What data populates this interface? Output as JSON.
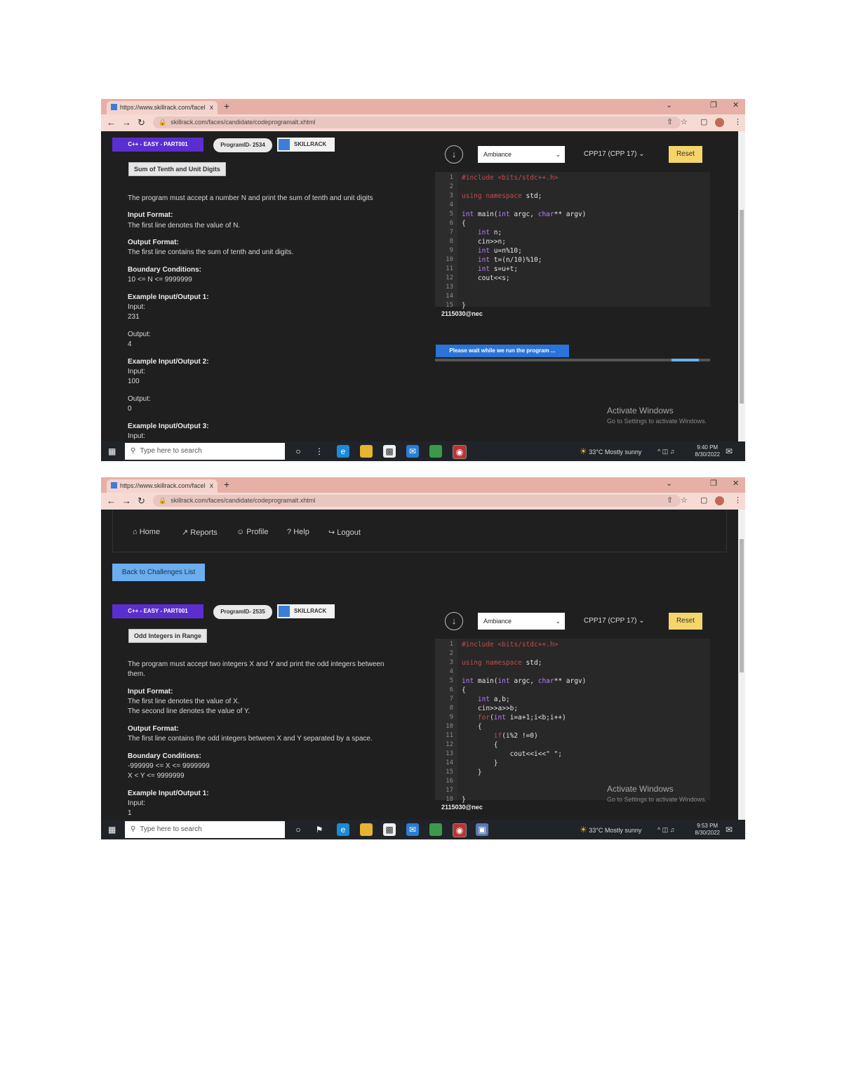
{
  "shot1": {
    "browser": {
      "tab_title": "https://www.skillrack.com/facel",
      "tab_close": "x",
      "new_tab": "+",
      "url": "skillrack.com/faces/candidate/codeprogramalt.xhtml"
    },
    "header": {
      "category_badge": "C++ - EASY - PART001",
      "program_id": "ProgramID- 2534",
      "logo_text": "SKILLRACK",
      "problem_title": "Sum of Tenth and Unit Digits"
    },
    "problem": {
      "statement": "The program must accept a number N and print the sum of tenth and unit digits",
      "input_format_label": "Input Format:",
      "input_format": "The first line denotes the value of N.",
      "output_format_label": "Output Format:",
      "output_format": "The first line contains the sum of tenth and unit digits.",
      "boundary_label": "Boundary Conditions:",
      "boundary": "10 <= N <= 9999999",
      "ex1_label": "Example Input/Output 1:",
      "input_label": "Input:",
      "ex1_input": "231",
      "output_label": "Output:",
      "ex1_output": "4",
      "ex2_label": "Example Input/Output 2:",
      "ex2_input": "100",
      "ex2_output": "0",
      "ex3_label": "Example Input/Output 3:",
      "ex3_input_label": "Input:"
    },
    "editor": {
      "theme": "Ambiance",
      "language": "CPP17 (CPP 17)",
      "reset": "Reset",
      "line_numbers": [
        "1",
        "2",
        "3",
        "4",
        "5",
        "6",
        "7",
        "8",
        "9",
        "10",
        "11",
        "12",
        "13",
        "14",
        "15"
      ],
      "username": "2115030@nec",
      "wait_message": "Please wait while we run the program ...",
      "progress_fraction": 0.1
    },
    "watermark": {
      "title": "Activate Windows",
      "subtitle": "Go to Settings to activate Windows."
    },
    "taskbar": {
      "search": "Type here to search",
      "weather": "33°C  Mostly sunny",
      "time": "9:40 PM",
      "date": "8/30/2022"
    }
  },
  "shot2": {
    "browser": {
      "tab_title": "https://www.skillrack.com/facel",
      "tab_close": "x",
      "new_tab": "+",
      "url": "skillrack.com/faces/candidate/codeprogramalt.xhtml"
    },
    "nav": {
      "home": "Home",
      "reports": "Reports",
      "profile": "Profile",
      "help": "Help",
      "logout": "Logout"
    },
    "back_button": "Back to Challenges List",
    "header": {
      "category_badge": "C++ - EASY - PART001",
      "program_id": "ProgramID- 2535",
      "logo_text": "SKILLRACK",
      "problem_title": "Odd Integers in Range"
    },
    "problem": {
      "statement_1": "The program must accept two integers X and Y and print the odd integers between",
      "statement_2": "them.",
      "input_format_label": "Input Format:",
      "input_format_1": "The first line denotes the value of X.",
      "input_format_2": "The second line denotes the value of Y.",
      "output_format_label": "Output Format:",
      "output_format": "The first line contains the odd integers between X and Y separated by a space.",
      "boundary_label": "Boundary Conditions:",
      "boundary_1": "-999999 <= X <= 9999999",
      "boundary_2": "X < Y <= 9999999",
      "ex1_label": "Example Input/Output 1:",
      "input_label": "Input:",
      "ex1_input": "1"
    },
    "editor": {
      "theme": "Ambiance",
      "language": "CPP17 (CPP 17)",
      "reset": "Reset",
      "line_numbers": [
        "1",
        "2",
        "3",
        "4",
        "5",
        "6",
        "7",
        "8",
        "9",
        "10",
        "11",
        "12",
        "13",
        "14",
        "15",
        "16",
        "17",
        "18"
      ],
      "username": "2115030@nec"
    },
    "watermark": {
      "title": "Activate Windows",
      "subtitle": "Go to Settings to activate Windows."
    },
    "taskbar": {
      "search": "Type here to search",
      "weather": "33°C  Mostly sunny",
      "time": "9:53 PM",
      "date": "8/30/2022"
    }
  }
}
